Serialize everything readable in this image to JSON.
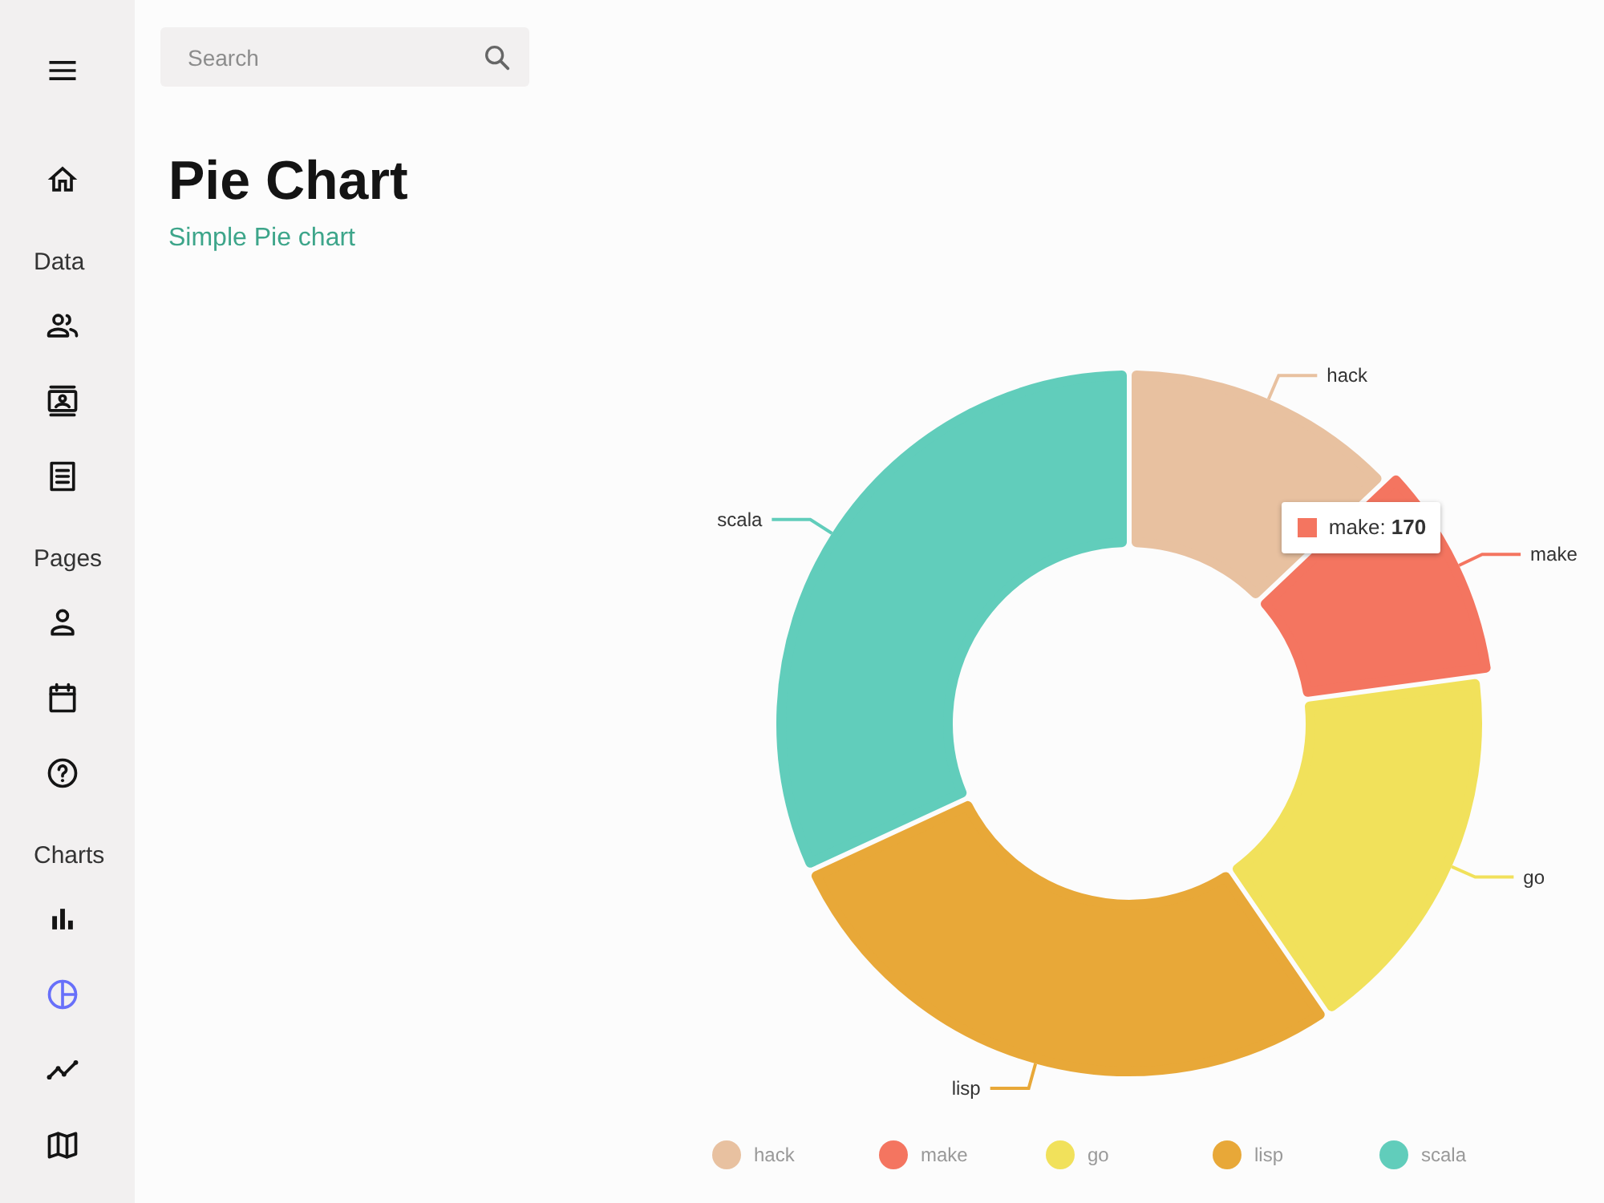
{
  "search": {
    "placeholder": "Search"
  },
  "sidebar": {
    "items": [
      {
        "kind": "link",
        "selected": false
      },
      {
        "kind": "heading",
        "label": "Data"
      },
      {
        "kind": "link",
        "selected": false
      },
      {
        "kind": "link",
        "selected": false
      },
      {
        "kind": "link",
        "selected": false
      },
      {
        "kind": "heading",
        "label": "Pages"
      },
      {
        "kind": "link",
        "selected": false
      },
      {
        "kind": "link",
        "selected": false
      },
      {
        "kind": "link",
        "selected": false
      },
      {
        "kind": "heading",
        "label": "Charts"
      },
      {
        "kind": "link",
        "selected": false
      },
      {
        "kind": "link",
        "selected": true
      },
      {
        "kind": "link",
        "selected": false
      },
      {
        "kind": "link",
        "selected": false
      }
    ]
  },
  "header": {
    "title": "Pie Chart",
    "subtitle": "Simple Pie chart"
  },
  "chart": {
    "slices": [
      {
        "label": "hack",
        "color": "#e8c1a0",
        "highlighted": false
      },
      {
        "label": "make",
        "color": "#f47560",
        "highlighted": true
      },
      {
        "label": "go",
        "color": "#f1e15b",
        "highlighted": false
      },
      {
        "label": "lisp",
        "color": "#e8a838",
        "highlighted": false
      },
      {
        "label": "scala",
        "color": "#61cdbb",
        "highlighted": false
      }
    ],
    "tooltip": "make: **170**",
    "legend": [
      {
        "label": "hack",
        "color": "#e8c1a0"
      },
      {
        "label": "make",
        "color": "#f47560"
      },
      {
        "label": "go",
        "color": "#f1e15b"
      },
      {
        "label": "lisp",
        "color": "#e8a838"
      },
      {
        "label": "scala",
        "color": "#61cdbb"
      }
    ]
  }
}
